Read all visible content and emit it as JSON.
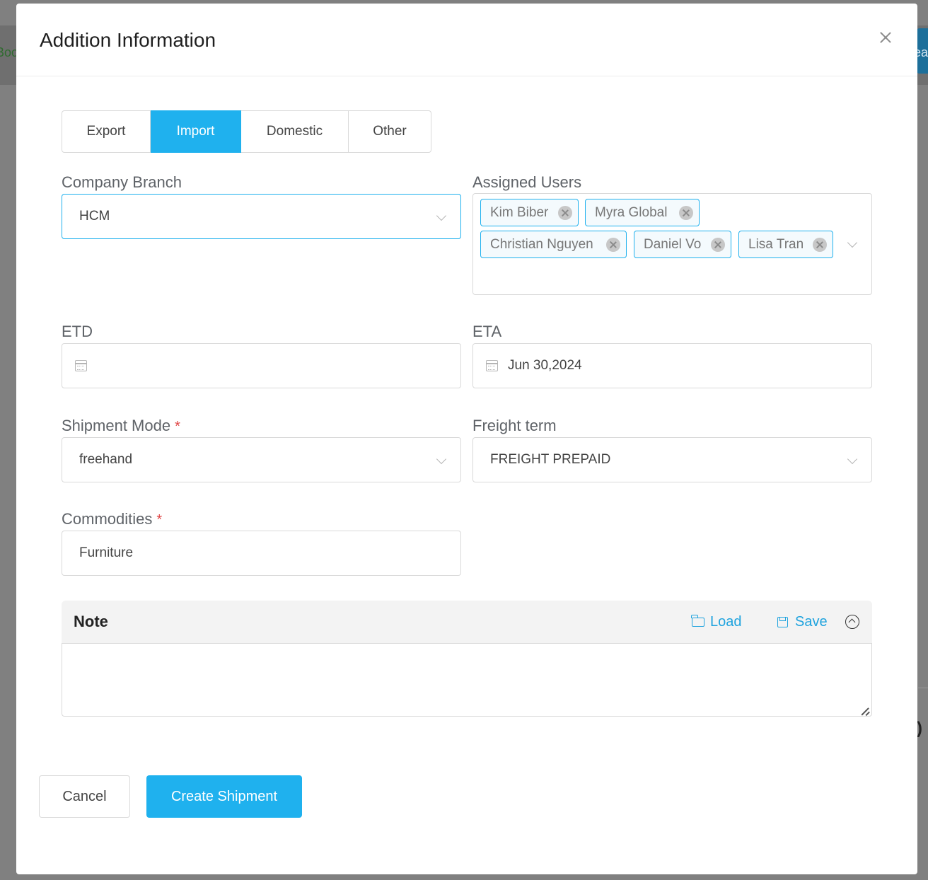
{
  "background": {
    "left_partial_text": "Boo",
    "right_partial_text": "ea",
    "right_partial_mark": ")"
  },
  "modal": {
    "title": "Addition Information"
  },
  "tabs": [
    {
      "label": "Export",
      "active": false
    },
    {
      "label": "Import",
      "active": true
    },
    {
      "label": "Domestic",
      "active": false
    },
    {
      "label": "Other",
      "active": false
    }
  ],
  "company_branch": {
    "label": "Company Branch",
    "value": "HCM"
  },
  "assigned_users": {
    "label": "Assigned Users",
    "tags": [
      "Kim Biber",
      "Myra Global",
      "Christian Nguyen",
      "Daniel Vo",
      "Lisa Tran"
    ]
  },
  "etd": {
    "label": "ETD",
    "value": ""
  },
  "eta": {
    "label": "ETA",
    "value": "Jun 30,2024"
  },
  "shipment_mode": {
    "label": "Shipment Mode",
    "required_mark": "*",
    "value": "freehand"
  },
  "freight_term": {
    "label": "Freight term",
    "value": "FREIGHT PREPAID"
  },
  "commodities": {
    "label": "Commodities",
    "required_mark": "*",
    "value": "Furniture"
  },
  "note": {
    "title": "Note",
    "load_label": "Load",
    "save_label": "Save",
    "value": ""
  },
  "footer": {
    "cancel_label": "Cancel",
    "create_label": "Create Shipment"
  },
  "colors": {
    "accent": "#1fb1ee",
    "required": "#e04545"
  }
}
